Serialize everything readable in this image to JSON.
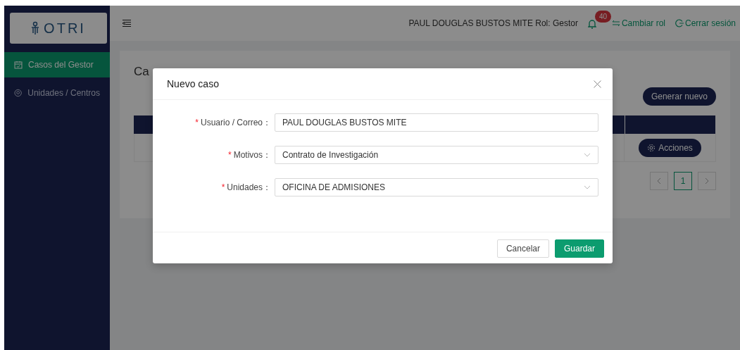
{
  "logo": {
    "text": "OTRI"
  },
  "sidebar": {
    "items": [
      {
        "label": "Casos del Gestor",
        "selected": true
      },
      {
        "label": "Unidades / Centros",
        "selected": false
      }
    ]
  },
  "header": {
    "user_info": "PAUL DOUGLAS BUSTOS MITE Rol: Gestor",
    "notifications": "40",
    "links": [
      {
        "label": "Cambiar rol"
      },
      {
        "label": "Cerrar sesión"
      }
    ]
  },
  "page": {
    "title": "Ca",
    "primary_button": "Generar nuevo",
    "table": {
      "rows": [
        {
          "action": "Acciones"
        }
      ]
    },
    "pagination": {
      "pages": [
        {
          "label": "1",
          "selected": true
        }
      ]
    }
  },
  "modal": {
    "title": "Nuevo caso",
    "fields": [
      {
        "required_mark": "*",
        "label": "Usuario / Correo：",
        "kind": "text",
        "value": "PAUL DOUGLAS BUSTOS MITE"
      },
      {
        "required_mark": "*",
        "label": "Motivos：",
        "kind": "select",
        "value": "Contrato de Investigación"
      },
      {
        "required_mark": "*",
        "label": "Unidades：",
        "kind": "select",
        "value": "OFICINA DE ADMISIONES"
      }
    ],
    "buttons": [
      {
        "label": "Cancelar",
        "kind": "secondary"
      },
      {
        "label": "Guardar",
        "kind": "primary"
      }
    ]
  }
}
